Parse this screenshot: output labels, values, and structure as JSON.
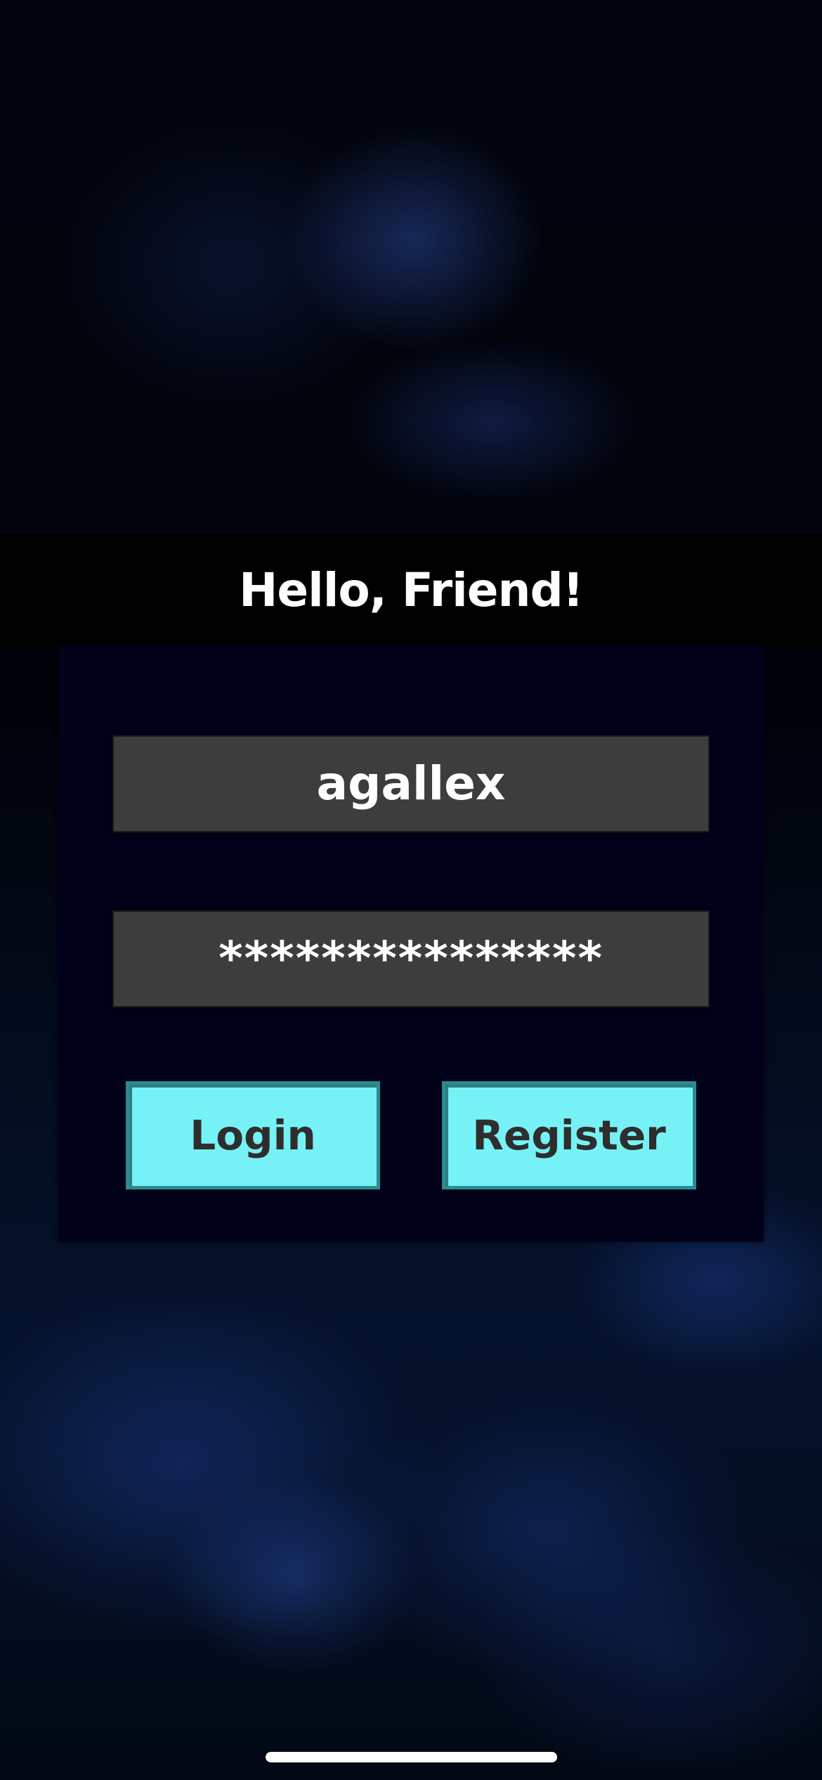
{
  "header": {
    "title": "Hello, Friend!"
  },
  "form": {
    "username_value": "agallex",
    "password_masked": "***************",
    "login_label": "Login",
    "register_label": "Register"
  },
  "colors": {
    "button_fill": "#76f2f6",
    "button_border": "#2d8a90",
    "field_fill": "#3d3d3d",
    "card_fill": "#01011a"
  }
}
